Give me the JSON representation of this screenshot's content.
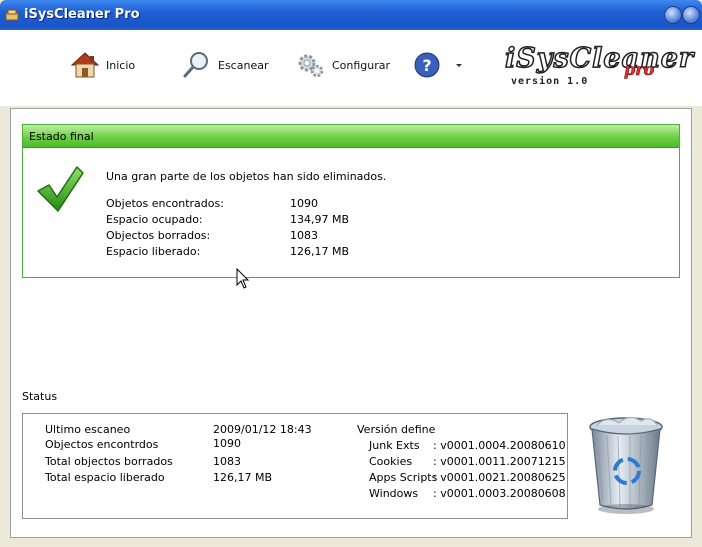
{
  "window": {
    "title": "iSysCleaner Pro"
  },
  "toolbar": {
    "inicio": "Inicio",
    "escanear": "Escanear",
    "configurar": "Configurar"
  },
  "brand": {
    "name": "iSysCleaner",
    "pro": "pro",
    "version": "version 1.0"
  },
  "estado": {
    "title": "Estado final",
    "message": "Una gran parte de los objetos han sido eliminados.",
    "rows": [
      {
        "label": "Objetos encontrados:",
        "value": "1090"
      },
      {
        "label": "Espacio ocupado:",
        "value": "134,97 MB"
      },
      {
        "label": "Objectos borrados:",
        "value": "1083"
      },
      {
        "label": "Espacio liberado:",
        "value": "126,17 MB"
      }
    ]
  },
  "status": {
    "label": "Status",
    "left": [
      {
        "label": "Ultimo escaneo",
        "value": "2009/01/12 18:43"
      },
      {
        "label": "Objectos encontrdos",
        "value": "1090"
      },
      {
        "label": "Total objectos borrados",
        "value": "1083"
      },
      {
        "label": "Total espacio liberado",
        "value": "126,17 MB"
      }
    ],
    "version_header": "Versión define",
    "versions": [
      {
        "label": "Junk Exts",
        "value": ": v0001.0004.20080610"
      },
      {
        "label": "Cookies",
        "value": ": v0001.0011.20071215"
      },
      {
        "label": "Apps Scripts",
        "value": ": v0001.0021.20080625"
      },
      {
        "label": "Windows",
        "value": ": v0001.0003.20080608"
      }
    ]
  },
  "colors": {
    "titlebar": "#1f5fd4",
    "estado_green": "#4fb82b",
    "check_green": "#2f9a1a"
  }
}
